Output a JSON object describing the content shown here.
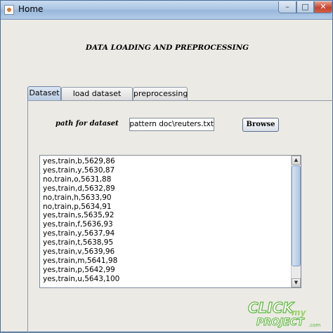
{
  "window": {
    "title": "Home"
  },
  "heading": "DATA LOADING AND PREPROCESSING",
  "tabs": [
    {
      "label": "Dataset",
      "active": true
    },
    {
      "label": "load dataset",
      "active": false
    },
    {
      "label": "preprocessing",
      "active": false
    }
  ],
  "path_section": {
    "label": "path for dataset",
    "value": "eeds\\pattern doc\\reuters.txt",
    "browse_label": "Browse"
  },
  "output_lines": [
    "yes,train,b,5629,86",
    "yes,train,y,5630,87",
    "no,train,o,5631,88",
    "yes,train,d,5632,89",
    "no,train,h,5633,90",
    "no,train,p,5634,91",
    "yes,train,s,5635,92",
    "yes,train,f,5636,93",
    "yes,train,y,5637,94",
    "yes,train,t,5638,95",
    "yes,train,v,5639,96",
    "yes,train,m,5641,98",
    "yes,train,p,5642,99",
    "yes,train,u,5643,100"
  ],
  "watermark": {
    "line1": "CLICK",
    "line2": "my",
    "line3": "PROJECT",
    "suffix": ".com"
  },
  "colors": {
    "accent": "#b9cce3",
    "close": "#c7442e",
    "watermark_green": "#5ab43c"
  }
}
